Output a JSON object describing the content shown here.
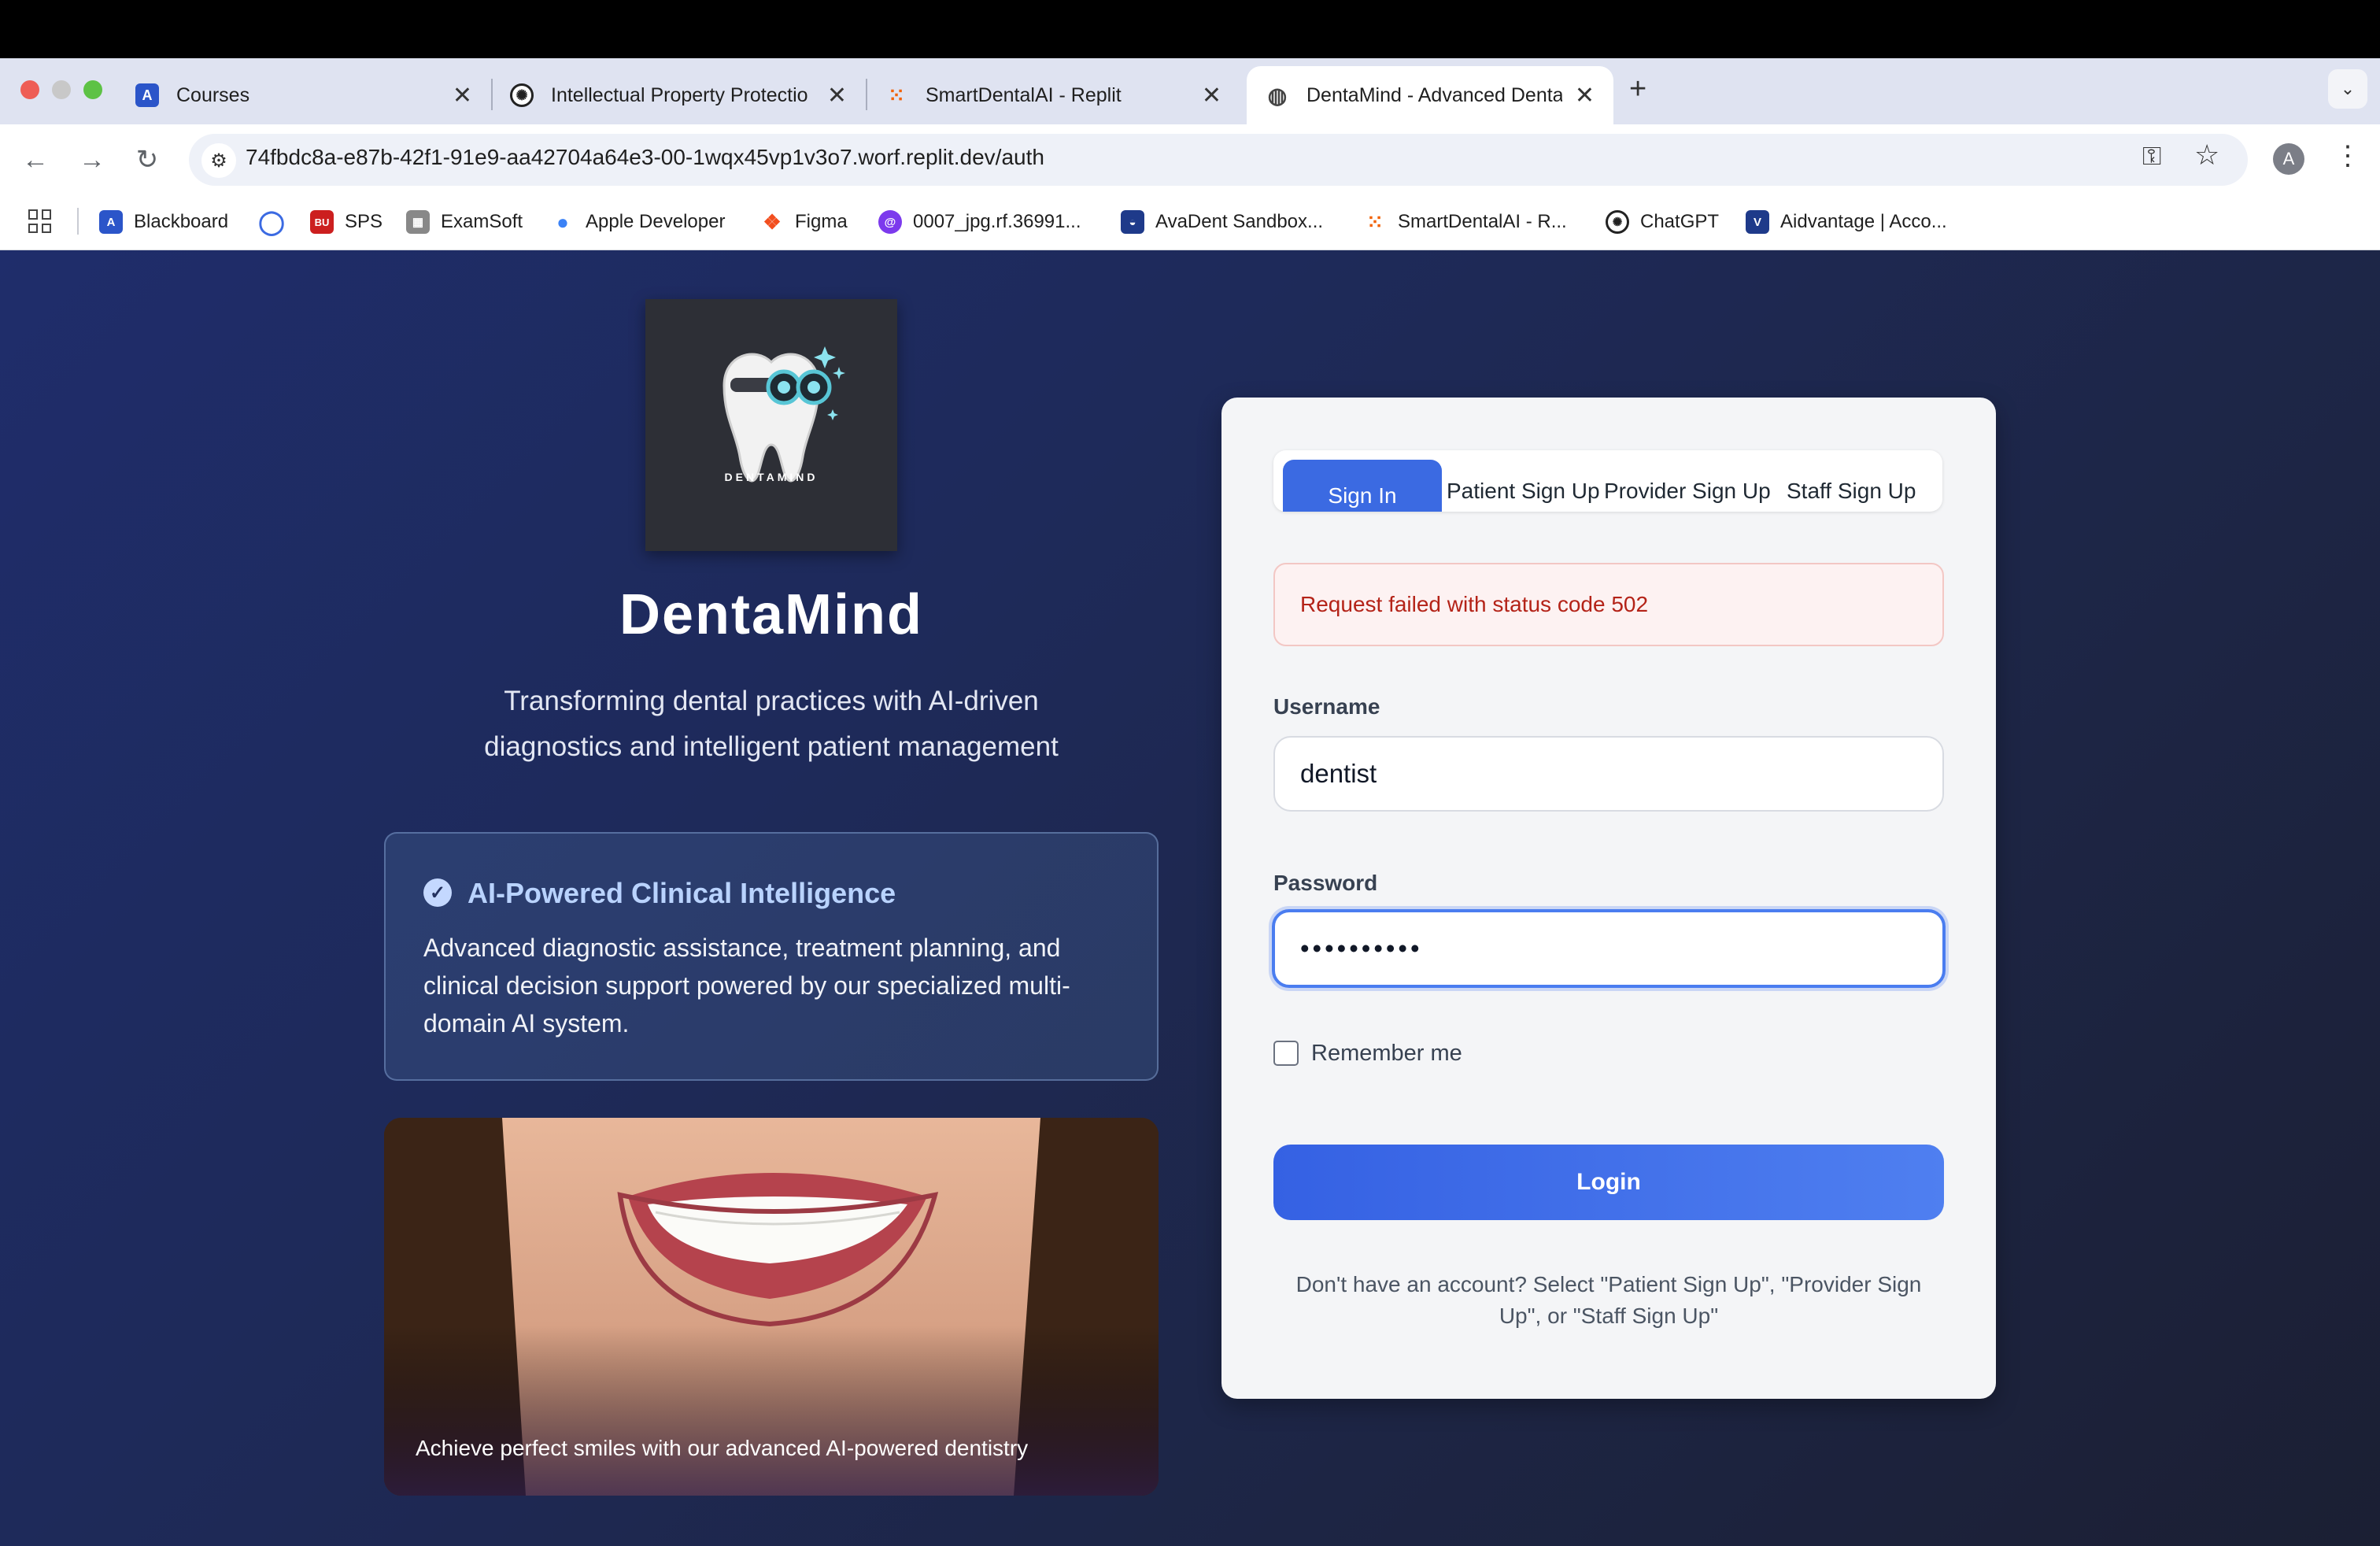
{
  "browser": {
    "tabs": [
      {
        "title": "Courses",
        "icon": "a-logo-icon"
      },
      {
        "title": "Intellectual Property Protectio",
        "icon": "openai-icon"
      },
      {
        "title": "SmartDentalAI - Replit",
        "icon": "replit-icon"
      },
      {
        "title": "DentaMind - Advanced Denta",
        "icon": "globe-icon",
        "active": true
      }
    ],
    "url": "74fbdc8a-e87b-42f1-91e9-aa42704a64e3-00-1wqx45vp1v3o7.worf.replit.dev/auth",
    "profile_initial": "A",
    "bookmarks": [
      "Blackboard",
      "",
      "SPS",
      "ExamSoft",
      "Apple Developer",
      "Figma",
      "0007_jpg.rf.36991...",
      "AvaDent Sandbox...",
      "SmartDentalAI - R...",
      "ChatGPT",
      "Aidvantage | Acco..."
    ],
    "bookmark_badges": {
      "sps": "BU"
    }
  },
  "brand": {
    "logo_text": "DENTAMIND",
    "title": "DentaMind",
    "tagline": "Transforming dental practices with AI-driven diagnostics and intelligent patient management"
  },
  "feature": {
    "title": "AI-Powered Clinical Intelligence",
    "description": "Advanced diagnostic assistance, treatment planning, and clinical decision support powered by our specialized multi-domain AI system."
  },
  "hero": {
    "caption": "Achieve perfect smiles with our advanced AI-powered dentistry"
  },
  "auth": {
    "tabs": [
      "Sign In",
      "Patient Sign Up",
      "Provider Sign Up",
      "Staff Sign Up"
    ],
    "error": "Request failed with status code 502",
    "username_label": "Username",
    "username_value": "dentist",
    "password_label": "Password",
    "password_value": "••••••••••",
    "remember_label": "Remember me",
    "login_label": "Login",
    "hint": "Don't have an account? Select \"Patient Sign Up\", \"Provider Sign Up\", or \"Staff Sign Up\""
  },
  "colors": {
    "accent": "#3b6ae2",
    "error_text": "#b42318",
    "page_bg": "#1e2a5a"
  }
}
